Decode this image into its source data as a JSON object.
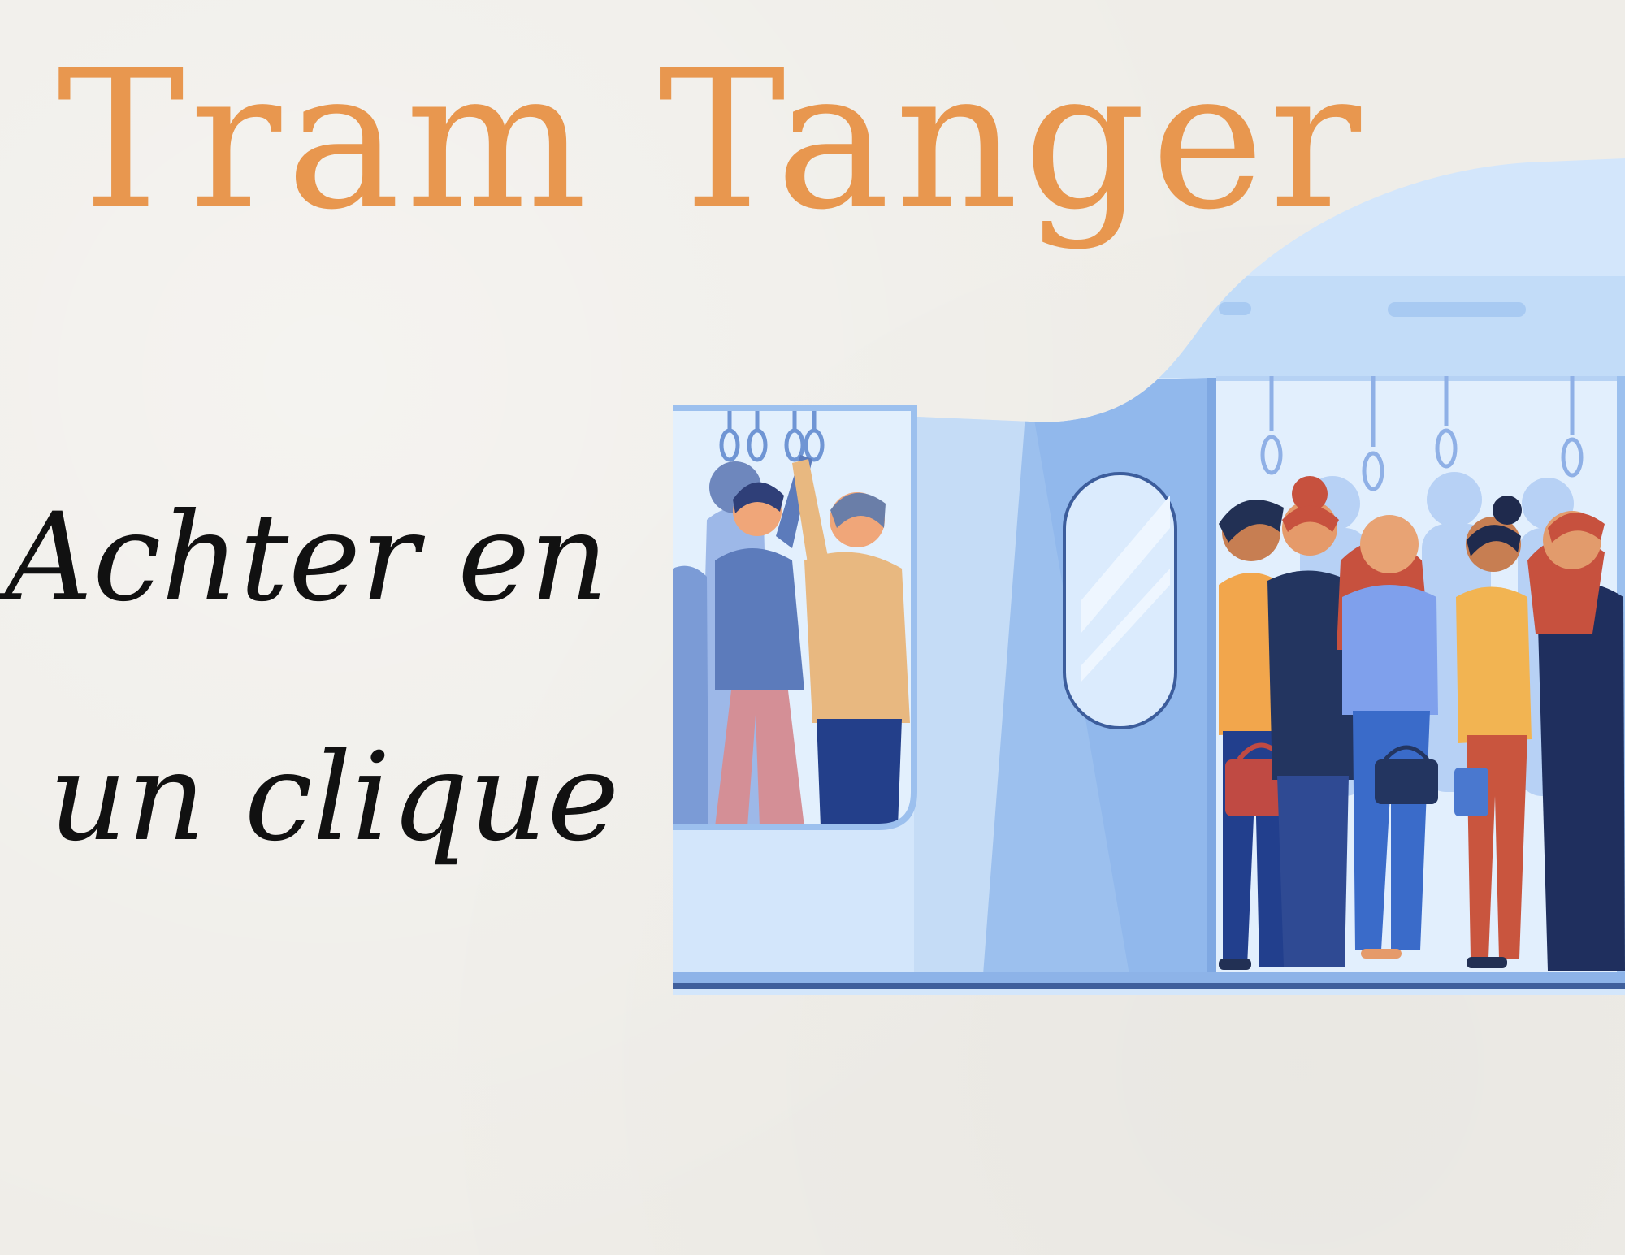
{
  "title": "Tram Tanger",
  "slogan": {
    "line1": "Achter en",
    "line2": "un clique"
  },
  "colors": {
    "title": "#e8974f",
    "background": "#efede8",
    "tram_light": "#cfe3fa",
    "tram_mid": "#9fc2ee",
    "tram_dark": "#4d73b8"
  },
  "illustration": {
    "icon": "tram-passengers-illustration"
  }
}
